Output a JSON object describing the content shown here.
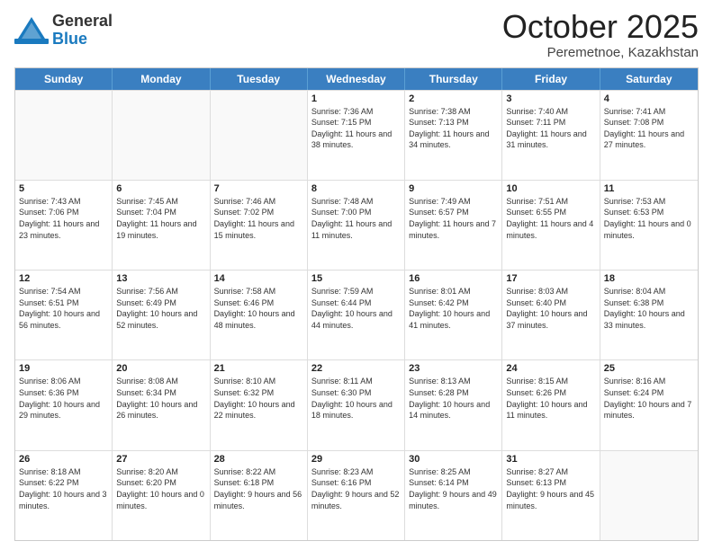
{
  "logo": {
    "general": "General",
    "blue": "Blue"
  },
  "title": "October 2025",
  "subtitle": "Peremetnoe, Kazakhstan",
  "days": [
    "Sunday",
    "Monday",
    "Tuesday",
    "Wednesday",
    "Thursday",
    "Friday",
    "Saturday"
  ],
  "weeks": [
    [
      {
        "date": "",
        "info": ""
      },
      {
        "date": "",
        "info": ""
      },
      {
        "date": "",
        "info": ""
      },
      {
        "date": "1",
        "info": "Sunrise: 7:36 AM\nSunset: 7:15 PM\nDaylight: 11 hours and 38 minutes."
      },
      {
        "date": "2",
        "info": "Sunrise: 7:38 AM\nSunset: 7:13 PM\nDaylight: 11 hours and 34 minutes."
      },
      {
        "date": "3",
        "info": "Sunrise: 7:40 AM\nSunset: 7:11 PM\nDaylight: 11 hours and 31 minutes."
      },
      {
        "date": "4",
        "info": "Sunrise: 7:41 AM\nSunset: 7:08 PM\nDaylight: 11 hours and 27 minutes."
      }
    ],
    [
      {
        "date": "5",
        "info": "Sunrise: 7:43 AM\nSunset: 7:06 PM\nDaylight: 11 hours and 23 minutes."
      },
      {
        "date": "6",
        "info": "Sunrise: 7:45 AM\nSunset: 7:04 PM\nDaylight: 11 hours and 19 minutes."
      },
      {
        "date": "7",
        "info": "Sunrise: 7:46 AM\nSunset: 7:02 PM\nDaylight: 11 hours and 15 minutes."
      },
      {
        "date": "8",
        "info": "Sunrise: 7:48 AM\nSunset: 7:00 PM\nDaylight: 11 hours and 11 minutes."
      },
      {
        "date": "9",
        "info": "Sunrise: 7:49 AM\nSunset: 6:57 PM\nDaylight: 11 hours and 7 minutes."
      },
      {
        "date": "10",
        "info": "Sunrise: 7:51 AM\nSunset: 6:55 PM\nDaylight: 11 hours and 4 minutes."
      },
      {
        "date": "11",
        "info": "Sunrise: 7:53 AM\nSunset: 6:53 PM\nDaylight: 11 hours and 0 minutes."
      }
    ],
    [
      {
        "date": "12",
        "info": "Sunrise: 7:54 AM\nSunset: 6:51 PM\nDaylight: 10 hours and 56 minutes."
      },
      {
        "date": "13",
        "info": "Sunrise: 7:56 AM\nSunset: 6:49 PM\nDaylight: 10 hours and 52 minutes."
      },
      {
        "date": "14",
        "info": "Sunrise: 7:58 AM\nSunset: 6:46 PM\nDaylight: 10 hours and 48 minutes."
      },
      {
        "date": "15",
        "info": "Sunrise: 7:59 AM\nSunset: 6:44 PM\nDaylight: 10 hours and 44 minutes."
      },
      {
        "date": "16",
        "info": "Sunrise: 8:01 AM\nSunset: 6:42 PM\nDaylight: 10 hours and 41 minutes."
      },
      {
        "date": "17",
        "info": "Sunrise: 8:03 AM\nSunset: 6:40 PM\nDaylight: 10 hours and 37 minutes."
      },
      {
        "date": "18",
        "info": "Sunrise: 8:04 AM\nSunset: 6:38 PM\nDaylight: 10 hours and 33 minutes."
      }
    ],
    [
      {
        "date": "19",
        "info": "Sunrise: 8:06 AM\nSunset: 6:36 PM\nDaylight: 10 hours and 29 minutes."
      },
      {
        "date": "20",
        "info": "Sunrise: 8:08 AM\nSunset: 6:34 PM\nDaylight: 10 hours and 26 minutes."
      },
      {
        "date": "21",
        "info": "Sunrise: 8:10 AM\nSunset: 6:32 PM\nDaylight: 10 hours and 22 minutes."
      },
      {
        "date": "22",
        "info": "Sunrise: 8:11 AM\nSunset: 6:30 PM\nDaylight: 10 hours and 18 minutes."
      },
      {
        "date": "23",
        "info": "Sunrise: 8:13 AM\nSunset: 6:28 PM\nDaylight: 10 hours and 14 minutes."
      },
      {
        "date": "24",
        "info": "Sunrise: 8:15 AM\nSunset: 6:26 PM\nDaylight: 10 hours and 11 minutes."
      },
      {
        "date": "25",
        "info": "Sunrise: 8:16 AM\nSunset: 6:24 PM\nDaylight: 10 hours and 7 minutes."
      }
    ],
    [
      {
        "date": "26",
        "info": "Sunrise: 8:18 AM\nSunset: 6:22 PM\nDaylight: 10 hours and 3 minutes."
      },
      {
        "date": "27",
        "info": "Sunrise: 8:20 AM\nSunset: 6:20 PM\nDaylight: 10 hours and 0 minutes."
      },
      {
        "date": "28",
        "info": "Sunrise: 8:22 AM\nSunset: 6:18 PM\nDaylight: 9 hours and 56 minutes."
      },
      {
        "date": "29",
        "info": "Sunrise: 8:23 AM\nSunset: 6:16 PM\nDaylight: 9 hours and 52 minutes."
      },
      {
        "date": "30",
        "info": "Sunrise: 8:25 AM\nSunset: 6:14 PM\nDaylight: 9 hours and 49 minutes."
      },
      {
        "date": "31",
        "info": "Sunrise: 8:27 AM\nSunset: 6:13 PM\nDaylight: 9 hours and 45 minutes."
      },
      {
        "date": "",
        "info": ""
      }
    ]
  ]
}
